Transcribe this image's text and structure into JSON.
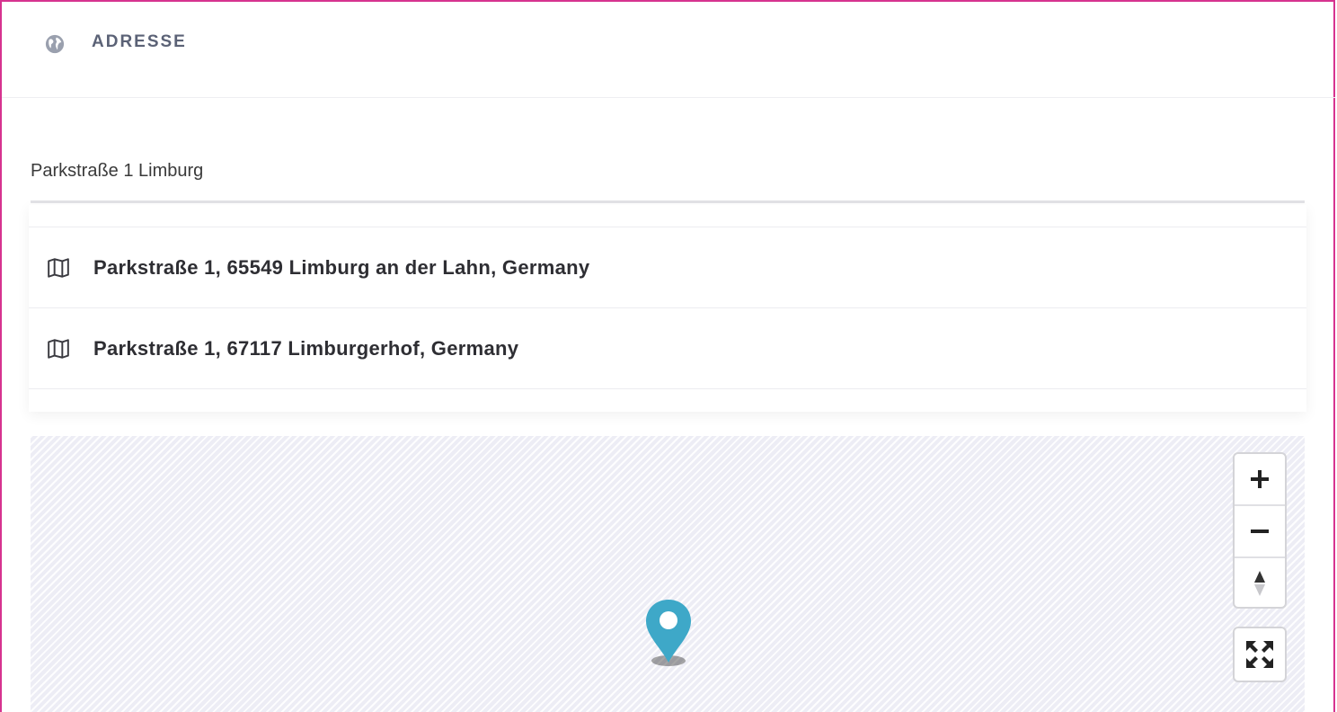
{
  "header": {
    "title": "ADRESSE",
    "icon": "globe-icon"
  },
  "search": {
    "value": "Parkstraße 1 Limburg"
  },
  "results": [
    {
      "label": "Parkstraße 1, 65549 Limburg an der Lahn, Germany",
      "icon": "map-icon"
    },
    {
      "label": "Parkstraße 1, 67117 Limburgerhof, Germany",
      "icon": "map-icon"
    }
  ],
  "map": {
    "marker_color": "#3ea8c8",
    "controls": [
      "zoom-in",
      "zoom-out",
      "compass",
      "fullscreen"
    ]
  },
  "colors": {
    "frame": "#d6338f",
    "heading": "#5b6276"
  }
}
